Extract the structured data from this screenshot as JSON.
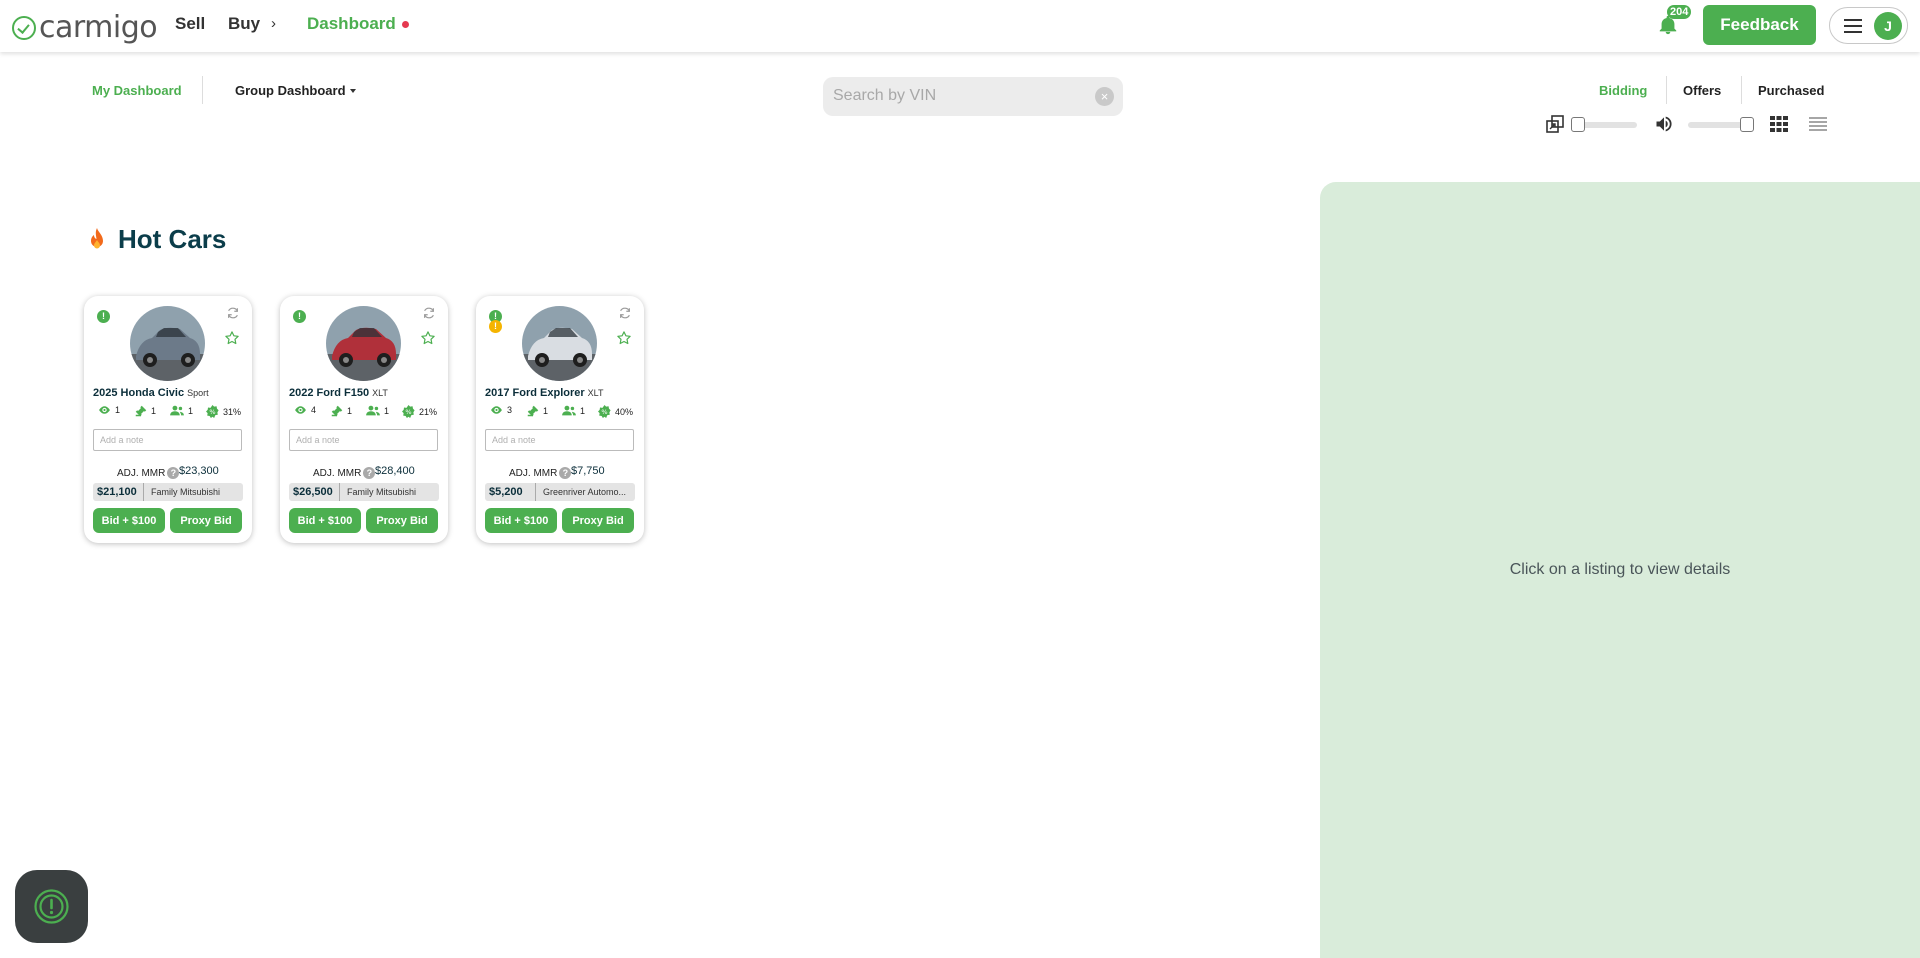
{
  "nav": {
    "logo_text": "carmigo",
    "sell": "Sell",
    "buy": "Buy",
    "buy_chevron": "›",
    "dashboard": "Dashboard",
    "notification_count": "204",
    "feedback": "Feedback",
    "avatar_initial": "J"
  },
  "subheader": {
    "my_dashboard": "My Dashboard",
    "group_dashboard": "Group Dashboard",
    "search_placeholder": "Search by VIN",
    "clear_glyph": "×",
    "tabs": [
      "Bidding",
      "Offers",
      "Purchased"
    ]
  },
  "controls": {
    "size_slider_value": 0,
    "volume_slider_value": 1,
    "view_grid_icon": "grid-icon",
    "view_list_icon": "list-icon"
  },
  "section": {
    "title": "Hot Cars"
  },
  "cards": [
    {
      "title": "2025 Honda Civic",
      "trim": "Sport",
      "views": "1",
      "bids": "1",
      "bidders": "1",
      "percent": "31%",
      "note_placeholder": "Add a note",
      "mmr_label": "ADJ. MMR",
      "mmr_value": "$23,300",
      "price": "$21,100",
      "dealer": "Family Mitsubishi",
      "bid_label": "Bid + $100",
      "proxy_label": "Proxy Bid",
      "status": "!",
      "photo_color": "#6c7a89"
    },
    {
      "title": "2022 Ford F150",
      "trim": "XLT",
      "views": "4",
      "bids": "1",
      "bidders": "1",
      "percent": "21%",
      "note_placeholder": "Add a note",
      "mmr_label": "ADJ. MMR",
      "mmr_value": "$28,400",
      "price": "$26,500",
      "dealer": "Family Mitsubishi",
      "bid_label": "Bid + $100",
      "proxy_label": "Proxy Bid",
      "status": "!",
      "photo_color": "#b0303a"
    },
    {
      "title": "2017 Ford Explorer",
      "trim": "XLT",
      "views": "3",
      "bids": "1",
      "bidders": "1",
      "percent": "40%",
      "note_placeholder": "Add a note",
      "mmr_label": "ADJ. MMR",
      "mmr_value": "$7,750",
      "price": "$5,200",
      "dealer": "Greenriver Automo...",
      "bid_label": "Bid + $100",
      "proxy_label": "Proxy Bid",
      "status": "!",
      "status2": "!",
      "photo_color": "#d9dde2"
    }
  ],
  "detail": {
    "empty_message": "Click on a listing to view details"
  },
  "colors": {
    "brand": "#4caf50",
    "panel": "#d9ecda",
    "title": "#0b3d4a"
  }
}
